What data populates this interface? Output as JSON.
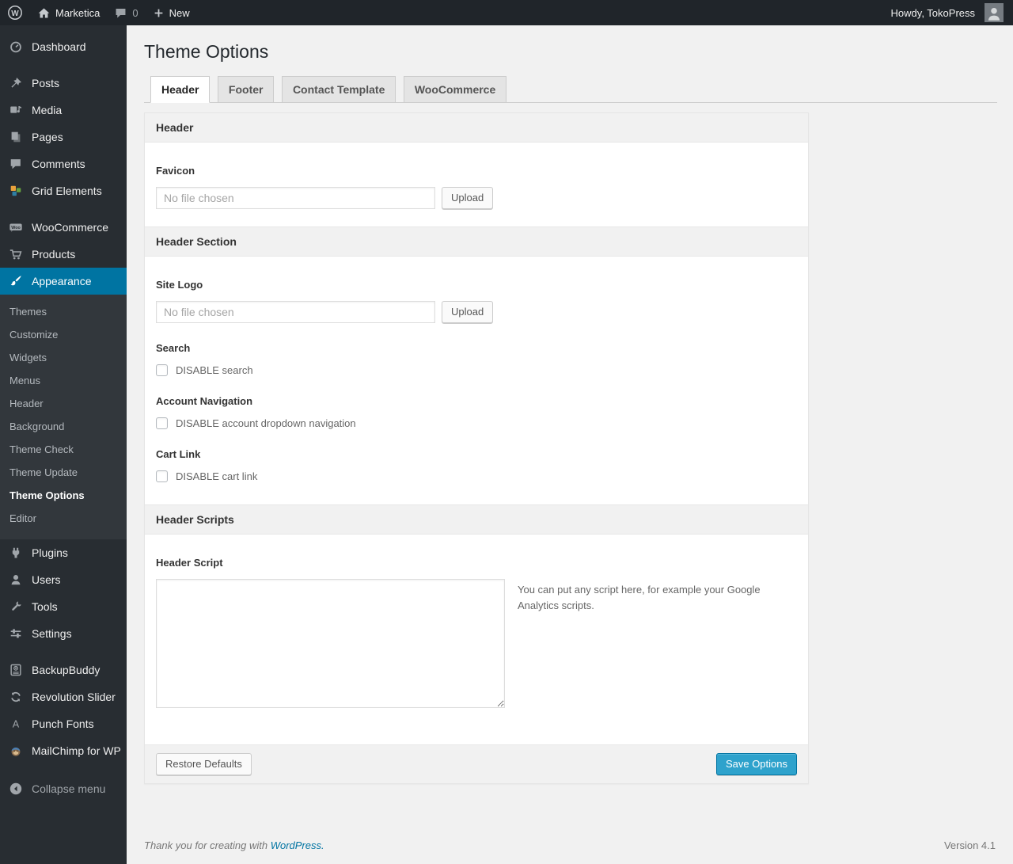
{
  "colors": {
    "accent": "#0074a2",
    "primary_button": "#2ea2cc",
    "sidebar_bg": "#282d32",
    "adminbar_bg": "#20252a",
    "content_bg": "#f1f1f1"
  },
  "admin_bar": {
    "site_name": "Marketica",
    "comments_count": "0",
    "new_label": "New",
    "howdy": "Howdy, TokoPress"
  },
  "sidebar": {
    "items": [
      "Dashboard",
      "Posts",
      "Media",
      "Pages",
      "Comments",
      "Grid Elements",
      "WooCommerce",
      "Products",
      "Appearance",
      "Plugins",
      "Users",
      "Tools",
      "Settings",
      "BackupBuddy",
      "Revolution Slider",
      "Punch Fonts",
      "MailChimp for WP"
    ],
    "submenu": [
      "Themes",
      "Customize",
      "Widgets",
      "Menus",
      "Header",
      "Background",
      "Theme Check",
      "Theme Update",
      "Theme Options",
      "Editor"
    ],
    "collapse_label": "Collapse menu"
  },
  "main": {
    "page_title": "Theme Options",
    "tabs": [
      "Header",
      "Footer",
      "Contact Template",
      "WooCommerce"
    ]
  },
  "panel": {
    "section1_title": "Header",
    "favicon_label": "Favicon",
    "file_placeholder": "No file chosen",
    "upload_label": "Upload",
    "section2_title": "Header Section",
    "site_logo_label": "Site Logo",
    "search_label": "Search",
    "search_checkbox": "DISABLE search",
    "account_nav_label": "Account Navigation",
    "account_nav_checkbox": "DISABLE account dropdown navigation",
    "cart_link_label": "Cart Link",
    "cart_link_checkbox": "DISABLE cart link",
    "section3_title": "Header Scripts",
    "header_script_label": "Header Script",
    "header_script_value": "",
    "header_script_help": "You can put any script here, for example your Google Analytics scripts.",
    "restore_button": "Restore Defaults",
    "save_button": "Save Options"
  },
  "footer": {
    "thanks_prefix": "Thank you for creating with",
    "wordpress_link": "WordPress.",
    "version": "Version 4.1"
  }
}
